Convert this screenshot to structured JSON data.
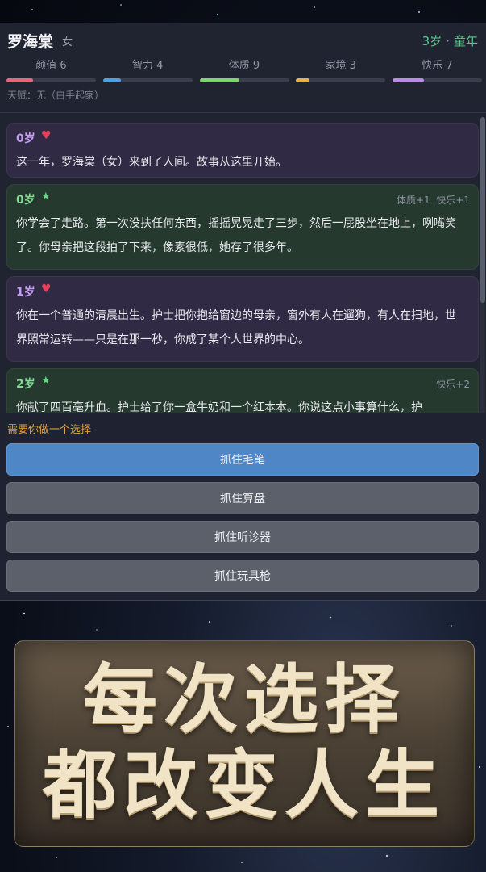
{
  "character": {
    "name": "罗海棠",
    "gender": "女",
    "age": "3岁",
    "stage": "童年",
    "talent": "天赋：无（白手起家）"
  },
  "attributes": [
    {
      "label": "颜值 6",
      "value": 6,
      "color": "#e8667a"
    },
    {
      "label": "智力 4",
      "value": 4,
      "color": "#4aa3e0"
    },
    {
      "label": "体质 9",
      "value": 9,
      "color": "#7ad86a"
    },
    {
      "label": "家境 3",
      "value": 3,
      "color": "#e8b24a"
    },
    {
      "label": "快乐 7",
      "value": 7,
      "color": "#b88be8"
    }
  ],
  "events": [
    {
      "age": "0岁",
      "icon": "heart",
      "effects": "",
      "text": "这一年，罗海棠（女）来到了人间。故事从这里开始。"
    },
    {
      "age": "0岁",
      "icon": "star",
      "effects": "体质+1  快乐+1",
      "text": "你学会了走路。第一次没扶任何东西，摇摇晃晃走了三步，然后一屁股坐在地上，咧嘴笑了。你母亲把这段拍了下来，像素很低，她存了很多年。"
    },
    {
      "age": "1岁",
      "icon": "heart",
      "effects": "",
      "text": "你在一个普通的清晨出生。护士把你抱给窗边的母亲，窗外有人在遛狗，有人在扫地，世界照常运转——只是在那一秒，你成了某个人世界的中心。"
    },
    {
      "age": "2岁",
      "icon": "star",
      "effects": "快乐+2",
      "text": "你献了四百毫升血。护士给了你一盒牛奶和一个红本本。你说这点小事算什么，护"
    }
  ],
  "choices": {
    "prompt": "需要你做一个选择",
    "options": [
      "抓住毛笔",
      "抓住算盘",
      "抓住听诊器",
      "抓住玩具枪"
    ]
  },
  "banner": {
    "line1": "每次选择",
    "line2": "都改变人生"
  }
}
